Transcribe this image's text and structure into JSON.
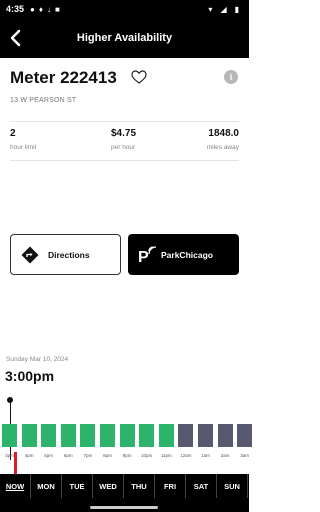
{
  "status": {
    "time": "4:35",
    "icons": [
      "sync-icon",
      "microphone-icon",
      "download-icon",
      "sim-icon"
    ],
    "right_icons": [
      "wifi-icon",
      "signal-icon",
      "battery-icon"
    ]
  },
  "header": {
    "title": "Higher Availability"
  },
  "meter": {
    "title": "Meter 222413",
    "address": "13 W PEARSON ST"
  },
  "stats": [
    {
      "value": "2",
      "label": "hour limit"
    },
    {
      "value": "$4.75",
      "label": "per hour"
    },
    {
      "value": "1848.0",
      "label": "miles away"
    }
  ],
  "buttons": {
    "directions": "Directions",
    "park": "ParkChicago"
  },
  "schedule": {
    "date": "Sunday Mar 10, 2024",
    "time": "3:00pm"
  },
  "availability": {
    "hours": [
      "3pm",
      "4pm",
      "5pm",
      "6pm",
      "7pm",
      "8pm",
      "9pm",
      "10pm",
      "11pm",
      "12am",
      "1am",
      "2am",
      "3am"
    ],
    "status": [
      "available",
      "available",
      "available",
      "available",
      "available",
      "available",
      "available",
      "available",
      "available",
      "unavailable",
      "unavailable",
      "unavailable",
      "unavailable"
    ],
    "colors": {
      "available": "#2db36b",
      "unavailable": "#575a6e"
    }
  },
  "days": [
    "NOW",
    "MON",
    "TUE",
    "WED",
    "THU",
    "FRI",
    "SAT",
    "SUN"
  ]
}
